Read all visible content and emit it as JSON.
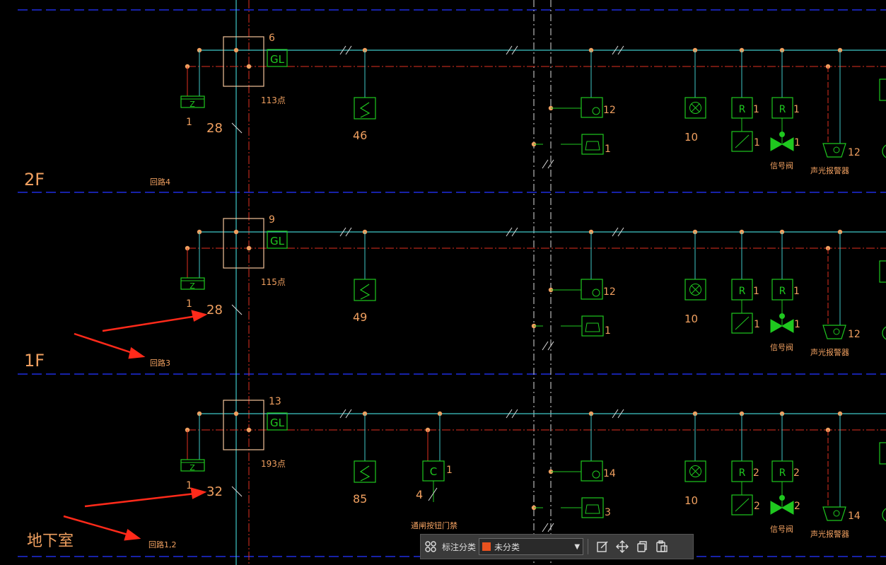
{
  "floors": [
    {
      "label": "2F",
      "loop": "回路4"
    },
    {
      "label": "1F",
      "loop": "回路3"
    },
    {
      "label": "地下室",
      "loop": "回路1,2"
    }
  ],
  "rows": [
    {
      "gl_count": "6",
      "points": "113点",
      "vertical_count": "28",
      "z_count": "1",
      "detector_count": "46",
      "phone_module_count": "12",
      "phone_count": "1",
      "manual_count": "10",
      "r1_count": "1",
      "r2_count": "1",
      "switch_count": "1",
      "valve_count": "1",
      "alarm_count": "12",
      "valve_label": "信号阀",
      "alarm_label": "声光报警器"
    },
    {
      "gl_count": "9",
      "points": "115点",
      "vertical_count": "28",
      "z_count": "1",
      "detector_count": "49",
      "phone_module_count": "12",
      "phone_count": "1",
      "manual_count": "10",
      "r1_count": "1",
      "r2_count": "1",
      "switch_count": "1",
      "valve_count": "1",
      "alarm_count": "12",
      "valve_label": "信号阀",
      "alarm_label": "声光报警器"
    },
    {
      "gl_count": "13",
      "points": "193点",
      "vertical_count": "32",
      "z_count": "1",
      "detector_count": "85",
      "c_count": "1",
      "c_sub_count": "4",
      "c_label": "通闸按钮门禁",
      "phone_module_count": "14",
      "phone_count": "3",
      "manual_count": "10",
      "r1_count": "2",
      "r2_count": "2",
      "switch_count": "2",
      "valve_count": "2",
      "alarm_count": "14",
      "valve_label": "信号阀",
      "alarm_label": "声光报警器"
    }
  ],
  "symbols": {
    "gl": "GL",
    "z": "Z",
    "r": "R",
    "c": "C"
  },
  "toolbar": {
    "label": "标注分类",
    "selected": "未分类",
    "selected_color": "#e8521f",
    "icons": [
      "grid-icon",
      "edit-icon",
      "move-icon",
      "copy-icon",
      "paste-icon"
    ]
  },
  "colors": {
    "background": "#000000",
    "cyan": "#3fc8c8",
    "green": "#1fc81f",
    "orange": "#f0a060",
    "red": "#e03020",
    "blue": "#1f2ee0",
    "annotation_arrow": "#ff2a1a"
  }
}
